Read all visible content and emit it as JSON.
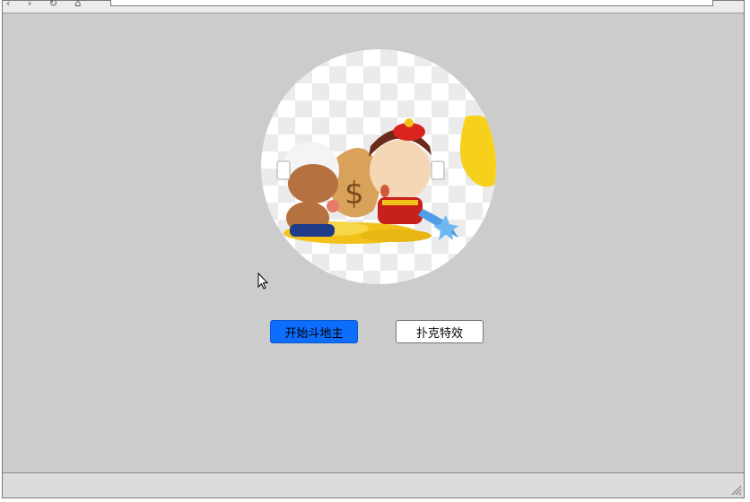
{
  "toolbar": {
    "nav_icons": "‹ › ↻ ⌂",
    "url_value": ""
  },
  "main": {
    "avatar_image": "cartoon-landlord-game-characters",
    "start_button_label": "开始斗地主",
    "poker_effects_button_label": "扑克特效"
  },
  "colors": {
    "primary": "#0d6efd",
    "background": "#cccccc"
  }
}
